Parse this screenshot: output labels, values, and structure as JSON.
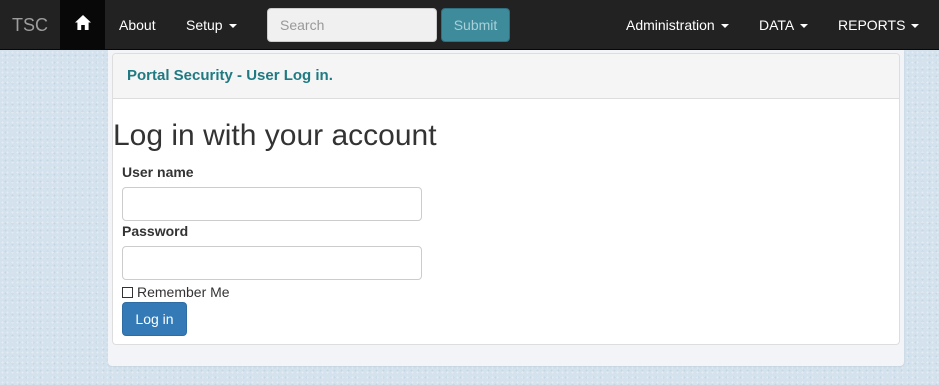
{
  "navbar": {
    "brand": "TSC",
    "home_icon": "home-icon",
    "about_label": "About",
    "setup_label": "Setup",
    "search": {
      "placeholder": "Search",
      "value": ""
    },
    "submit_label": "Submit",
    "administration_label": "Administration",
    "data_label": "DATA",
    "reports_label": "REPORTS"
  },
  "panel": {
    "heading": "Portal Security - User Log in."
  },
  "login": {
    "heading": "Log in with your account",
    "username_label": "User name",
    "username_value": "",
    "password_label": "Password",
    "password_value": "",
    "remember_label": "Remember Me",
    "remember_checked": false,
    "login_button": "Log in"
  },
  "colors": {
    "navbar_bg": "#222222",
    "brand_text": "#9d9d9d",
    "submit_bg": "#3e8b9c",
    "panel_heading_text": "#1f7a82",
    "primary_button": "#337ab7",
    "page_bg": "#d4e2ee"
  }
}
